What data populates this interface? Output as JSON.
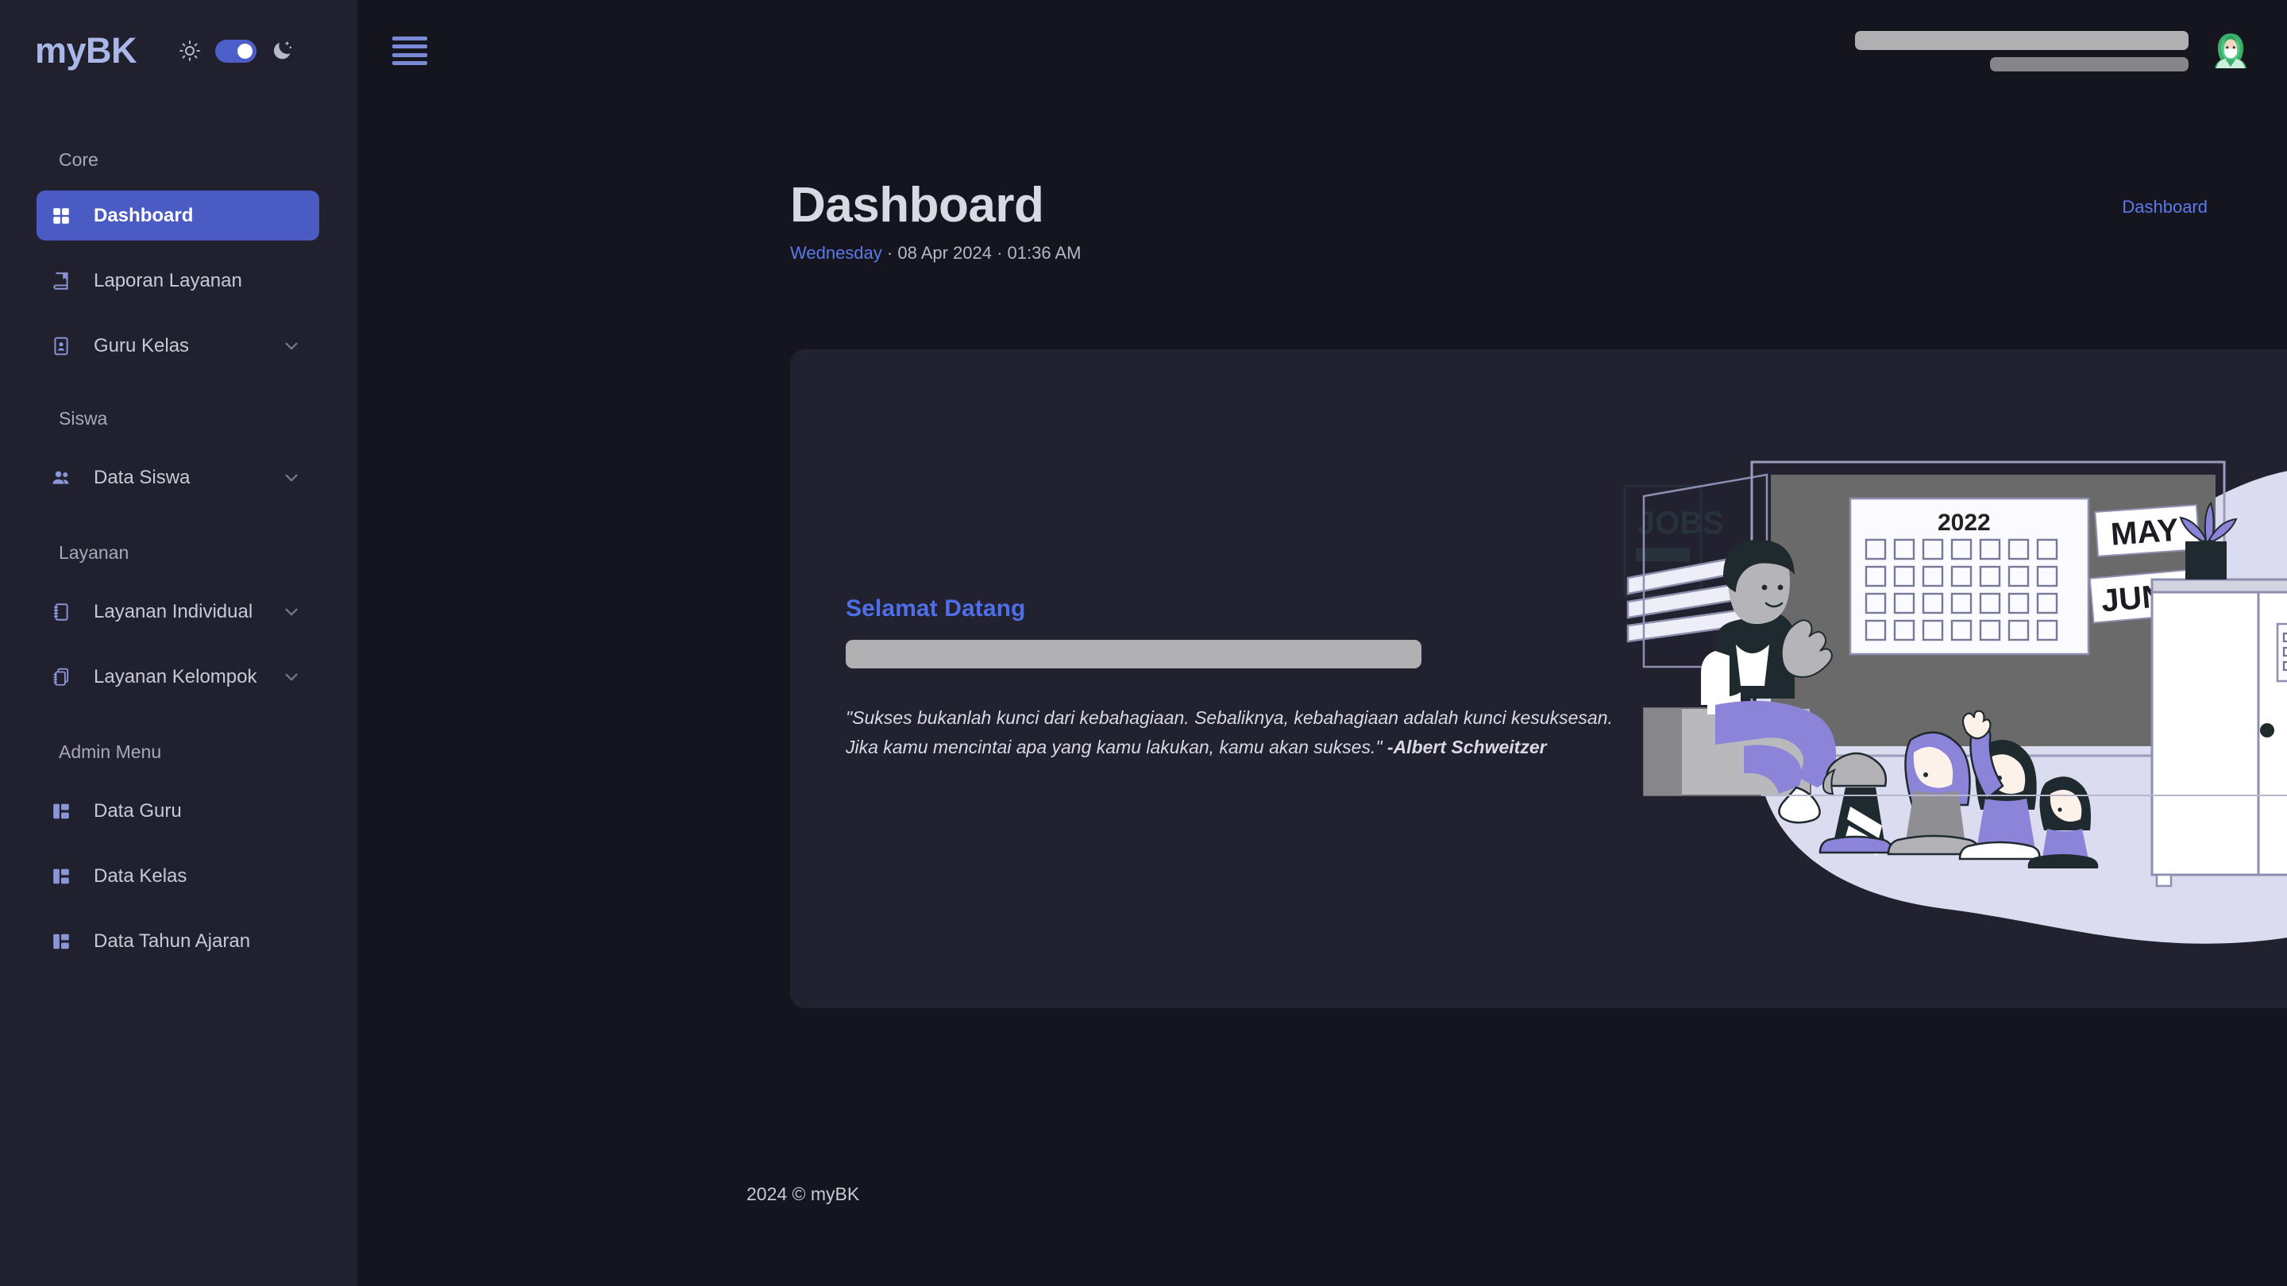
{
  "brand": {
    "name": "myBK",
    "sun_icon": "sun-icon",
    "moon_icon": "moon-icon",
    "toggle_state": "dark",
    "accent": "#4c5ec7"
  },
  "sidebar": {
    "sections": [
      {
        "title": "Core",
        "items": [
          {
            "label": "Dashboard",
            "icon": "grid-icon",
            "active": true,
            "expandable": false
          },
          {
            "label": "Laporan Layanan",
            "icon": "book-icon",
            "active": false,
            "expandable": false
          },
          {
            "label": "Guru Kelas",
            "icon": "id-card-icon",
            "active": false,
            "expandable": true
          }
        ]
      },
      {
        "title": "Siswa",
        "items": [
          {
            "label": "Data Siswa",
            "icon": "users-icon",
            "active": false,
            "expandable": true
          }
        ]
      },
      {
        "title": "Layanan",
        "items": [
          {
            "label": "Layanan Individual",
            "icon": "notebook-icon",
            "active": false,
            "expandable": true
          },
          {
            "label": "Layanan Kelompok",
            "icon": "notebooks-icon",
            "active": false,
            "expandable": true
          }
        ]
      },
      {
        "title": "Admin Menu",
        "items": [
          {
            "label": "Data Guru",
            "icon": "layout-icon",
            "active": false,
            "expandable": false
          },
          {
            "label": "Data Kelas",
            "icon": "layout-icon",
            "active": false,
            "expandable": false
          },
          {
            "label": "Data Tahun Ajaran",
            "icon": "layout-icon",
            "active": false,
            "expandable": false
          }
        ]
      }
    ]
  },
  "topbar": {
    "menu_icon": "hamburger-icon",
    "user_name_redacted": true,
    "user_role_redacted": true,
    "avatar_icon": "avatar-hijab-icon"
  },
  "page": {
    "title": "Dashboard",
    "date_day": "Wednesday",
    "date_rest": " · 08 Apr 2024 · 01:36 AM",
    "breadcrumb": "Dashboard"
  },
  "welcome": {
    "title": "Selamat Datang",
    "name_redacted": true,
    "quote_line1": "\"Sukses bukanlah kunci dari kebahagiaan. Sebaliknya, kebahagiaan adalah kunci kesuksesan.",
    "quote_line2": "Jika kamu mencintai apa yang kamu lakukan, kamu akan sukses.\" ",
    "author": "-Albert Schweitzer",
    "illustration": {
      "name": "classroom-illustration",
      "poster_label": "JOBS",
      "calendar_year": "2022",
      "month_1": "MAY",
      "month_2": "JUNE"
    }
  },
  "footer": {
    "text": "2024 © myBK"
  },
  "colors": {
    "sidebar_bg": "#21202e",
    "content_bg": "#15151f",
    "card_bg": "#21212f",
    "accent_blue": "#4a5cc4",
    "link_blue": "#5c7ae9",
    "illustration_blob": "#dcdcf0",
    "illustration_purple": "#8b84d8"
  }
}
